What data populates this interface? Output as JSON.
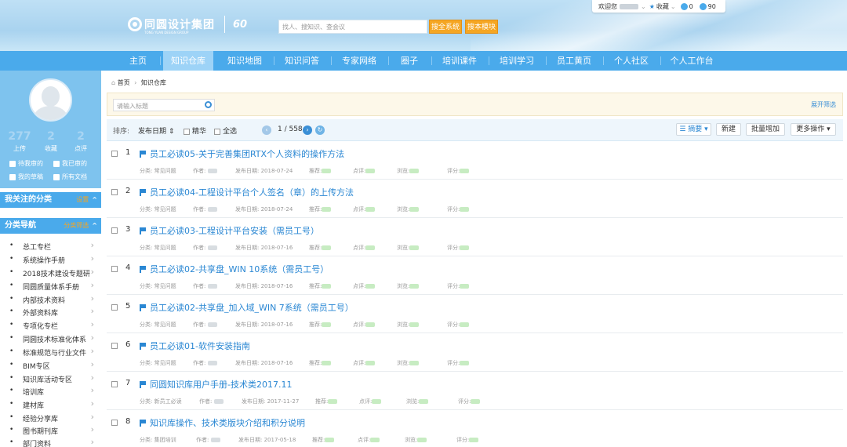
{
  "header": {
    "logo_text": "同圆设计集团",
    "logo_sub": "TONG YUAN DESIGN GROUP",
    "logo_mark": "60",
    "search_placeholder": "找人、搜知识、查会议",
    "search_all_label": "搜全系统",
    "search_module_label": "搜本模块",
    "welcome": "欢迎您",
    "favorites": "收藏",
    "count_a": "0",
    "count_b": "90"
  },
  "nav": {
    "items": [
      "主页",
      "知识仓库",
      "知识地图",
      "知识问答",
      "专家网络",
      "圈子",
      "培训课件",
      "培训学习",
      "员工黄页",
      "个人社区",
      "个人工作台"
    ],
    "active_index": 1
  },
  "sidebar": {
    "stats": [
      {
        "value": "277",
        "label": "上传"
      },
      {
        "value": "2",
        "label": "收藏"
      },
      {
        "value": "2",
        "label": "点评"
      }
    ],
    "links": [
      "待我审的",
      "我已审的",
      "我的草稿",
      "所有文档"
    ],
    "followed_title": "我关注的分类",
    "followed_action": "设置",
    "nav_title": "分类导航",
    "nav_action": "分类筛选",
    "categories": [
      "总工专栏",
      "系统操作手册",
      "2018技术建设专题研",
      "同圆质量体系手册",
      "内部技术资料",
      "外部资料库",
      "专项化专栏",
      "同圆技术标准化体系",
      "标准规范与行业文件",
      "BIM专区",
      "知识库活动专区",
      "培训库",
      "建材库",
      "经验分享库",
      "图书期刊库",
      "部门资料"
    ]
  },
  "main": {
    "breadcrumb_home": "首页",
    "breadcrumb_sep": "›",
    "breadcrumb_current": "知识仓库",
    "filter_placeholder": "请输入标题",
    "expand_label": "展开筛选",
    "sort_label": "排序:",
    "sort_field": "发布日期 ⇕",
    "essence_label": "精华",
    "select_all_label": "全选",
    "page_current": "1",
    "page_total": "558",
    "page_text": "1 / 558",
    "view_label": "摘要",
    "new_label": "新建",
    "batch_add_label": "批量增加",
    "more_label": "更多操作",
    "meta_labels": {
      "category": "分类:",
      "author": "作者:",
      "date": "发布日期:",
      "recommend": "推荐:",
      "comments": "点评:",
      "views": "浏览:",
      "score": "评分:"
    },
    "rows": [
      {
        "num": "1",
        "title": "员工必读05-关于完善集团RTX个人资料的操作方法",
        "category": "常见问题",
        "date": "2018-07-24"
      },
      {
        "num": "2",
        "title": "员工必读04-工程设计平台个人签名（章）的上传方法",
        "category": "常见问题",
        "date": "2018-07-24"
      },
      {
        "num": "3",
        "title": "员工必读03-工程设计平台安装（需员工号）",
        "category": "常见问题",
        "date": "2018-07-16"
      },
      {
        "num": "4",
        "title": "员工必读02-共享盘_WIN 10系统（需员工号）",
        "category": "常见问题",
        "date": "2018-07-16"
      },
      {
        "num": "5",
        "title": "员工必读02-共享盘_加入域_WIN 7系统（需员工号）",
        "category": "常见问题",
        "date": "2018-07-16"
      },
      {
        "num": "6",
        "title": "员工必读01-软件安装指南",
        "category": "常见问题",
        "date": "2018-07-16"
      },
      {
        "num": "7",
        "title": "同圆知识库用户手册-技术类2017.11",
        "category": "新员工必读",
        "date": "2017-11-27"
      },
      {
        "num": "8",
        "title": "知识库操作、技术类版块介绍和积分说明",
        "category": "集团培训",
        "date": "2017-05-18"
      }
    ]
  }
}
